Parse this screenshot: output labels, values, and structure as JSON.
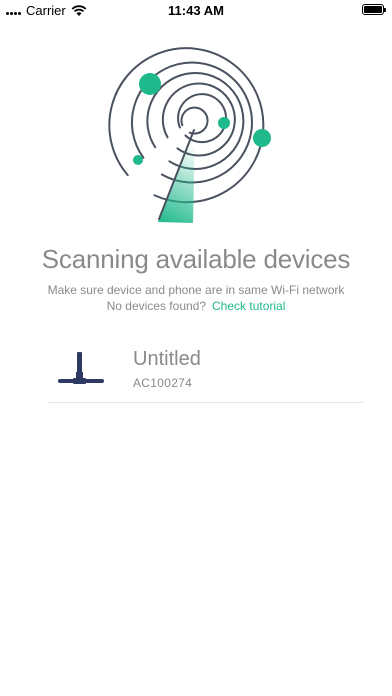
{
  "status_bar": {
    "carrier": "Carrier",
    "time": "11:43 AM"
  },
  "header": {
    "title": "Scanning available devices",
    "subtitle": "Make sure device and phone are in same Wi-Fi network",
    "no_devices_text": "No devices found?",
    "tutorial_link": "Check tutorial"
  },
  "devices": [
    {
      "name": "Untitled",
      "id": "AC100274",
      "icon": "mop-device-icon"
    }
  ],
  "colors": {
    "accent": "#1fb98c",
    "ring": "#4a5260",
    "text_muted": "#8a8a8a",
    "device_icon": "#2e3a62"
  }
}
